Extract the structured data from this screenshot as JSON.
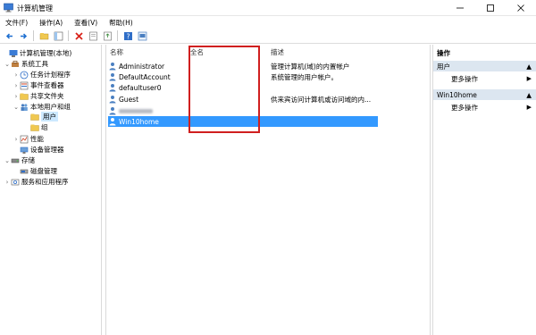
{
  "window": {
    "title": "计算机管理"
  },
  "menu": {
    "file": "文件(F)",
    "action": "操作(A)",
    "view": "查看(V)",
    "help": "帮助(H)"
  },
  "toolbar": {
    "icons": [
      "back-icon",
      "forward-icon",
      "up-folder-icon",
      "show-tree-icon",
      "delete-icon",
      "properties-icon",
      "export-icon",
      "help-icon",
      "console-icon"
    ]
  },
  "tree": {
    "root": "计算机管理(本地)",
    "system_tools": "系统工具",
    "task_scheduler": "任务计划程序",
    "event_viewer": "事件查看器",
    "shared_folders": "共享文件夹",
    "local_users_groups": "本地用户和组",
    "users": "用户",
    "groups": "组",
    "performance": "性能",
    "device_manager": "设备管理器",
    "storage": "存储",
    "disk_management": "磁盘管理",
    "services_apps": "服务和应用程序"
  },
  "list": {
    "col_name": "名称",
    "col_fullname": "全名",
    "col_desc": "描述",
    "rows": [
      {
        "name": "Administrator",
        "desc": "管理计算机(域)的内置帐户"
      },
      {
        "name": "DefaultAccount",
        "desc": "系统管理的用户帐户。"
      },
      {
        "name": "defaultuser0",
        "desc": ""
      },
      {
        "name": "Guest",
        "desc": "供来宾访问计算机或访问域的内..."
      },
      {
        "name": "",
        "desc": ""
      },
      {
        "name": "Win10home",
        "desc": ""
      }
    ]
  },
  "actions": {
    "header": "操作",
    "section1": "用户",
    "more1": "更多操作",
    "section2": "Win10home",
    "more2": "更多操作"
  },
  "colors": {
    "selection": "#3399ff",
    "highlight_box": "#d01f1f",
    "action_header_bg": "#dce6f0"
  }
}
